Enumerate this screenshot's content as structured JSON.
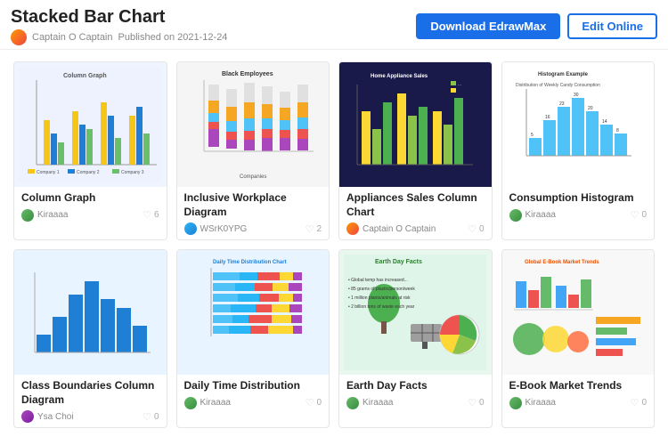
{
  "header": {
    "title": "Stacked Bar Chart",
    "author": "Captain O Captain",
    "published": "Published on 2021-12-24",
    "btn_download": "Download EdrawMax",
    "btn_edit": "Edit Online"
  },
  "cards": [
    {
      "id": "column-graph",
      "title": "Column Graph",
      "author": "Kiraaaa",
      "likes": "6",
      "thumb_type": "column-graph"
    },
    {
      "id": "inclusive-workplace",
      "title": "Inclusive Workplace Diagram",
      "author": "WSrK0YPG",
      "likes": "2",
      "thumb_type": "inclusive"
    },
    {
      "id": "appliances-sales",
      "title": "Appliances Sales Column Chart",
      "author": "Captain O Captain",
      "likes": "0",
      "thumb_type": "appliances"
    },
    {
      "id": "consumption-histogram",
      "title": "Consumption Histogram",
      "author": "Kiraaaa",
      "likes": "0",
      "thumb_type": "histogram"
    },
    {
      "id": "class-boundaries",
      "title": "Class Boundaries Column Diagram",
      "author": "Ysa Choi",
      "likes": "0",
      "thumb_type": "class-boundaries"
    },
    {
      "id": "daily-time",
      "title": "Daily Time Distribution",
      "author": "Kiraaaa",
      "likes": "0",
      "thumb_type": "daily-time"
    },
    {
      "id": "earth-day",
      "title": "Earth Day Facts",
      "author": "Kiraaaa",
      "likes": "0",
      "thumb_type": "earth-day"
    },
    {
      "id": "ebook-trends",
      "title": "E-Book Market Trends",
      "author": "Kiraaaa",
      "likes": "0",
      "thumb_type": "ebook"
    }
  ]
}
